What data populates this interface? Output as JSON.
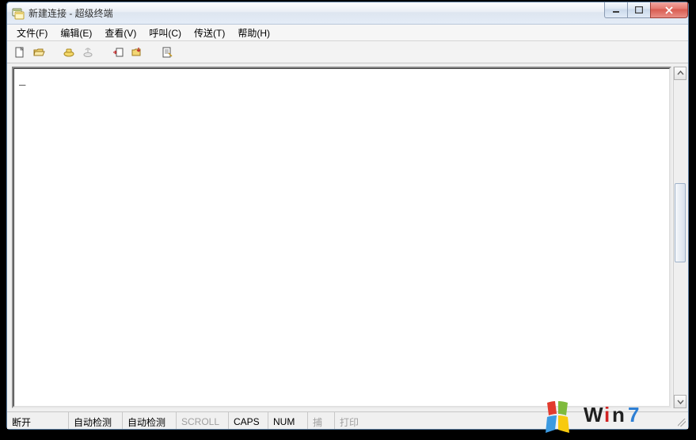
{
  "window": {
    "title": "新建连接 - 超级终端"
  },
  "menu": {
    "items": [
      {
        "label": "文件(F)"
      },
      {
        "label": "编辑(E)"
      },
      {
        "label": "查看(V)"
      },
      {
        "label": "呼叫(C)"
      },
      {
        "label": "传送(T)"
      },
      {
        "label": "帮助(H)"
      }
    ]
  },
  "toolbar": {
    "icons": [
      "new-icon",
      "open-icon",
      "connect-icon",
      "disconnect-icon",
      "send-icon",
      "receive-icon",
      "properties-icon"
    ]
  },
  "terminal": {
    "content": "_"
  },
  "status": {
    "connection": "断开",
    "detect1": "自动检测",
    "detect2": "自动检测",
    "scroll": "SCROLL",
    "caps": "CAPS",
    "num": "NUM",
    "capture": "捕",
    "print": "打印"
  },
  "watermark": {
    "text": "Win7"
  }
}
